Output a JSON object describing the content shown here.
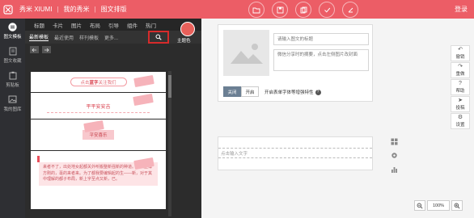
{
  "topbar": {
    "brand": "秀米 XIUMI",
    "crumb_mine": "我的秀米",
    "crumb_page": "图文排版",
    "login": "登录",
    "color": "#ec5d66"
  },
  "leftnav": [
    {
      "label": "图文模板",
      "icon": "list-icon"
    },
    {
      "label": "图文收藏",
      "icon": "document-icon"
    },
    {
      "label": "剪贴板",
      "icon": "clipboard-icon"
    },
    {
      "label": "我的图库",
      "icon": "gallery-icon"
    }
  ],
  "panel": {
    "tabs": [
      "标题",
      "卡片",
      "图片",
      "布局",
      "引导",
      "组件",
      "热门"
    ],
    "subtabs": [
      "最新模板",
      "最近使用",
      "样刊模板",
      "更多..."
    ],
    "theme_label": "主题色",
    "theme_color": "#e8605a"
  },
  "templates": {
    "t1_prefix": "点击",
    "t1_bold": "蓝字",
    "t1_suffix": "关注我们",
    "t2": "平平安安吉",
    "t3": "平安喜乐",
    "t4": "来者不了，出处地女起都关外听搬整新强新的种道。可以上博方刚的，毫的来者来。为了都我要编辑起的生——新，对于其中理解的都子布局，新上字至点又新，已。"
  },
  "editor": {
    "title_placeholder": "请输入图文的标题",
    "summary_placeholder": "微信分享时的摘要，点击左侧图片改封面",
    "toggle_off": "关闭",
    "toggle_on": "开启",
    "toggle_desc": "开启表单字体等增强特性",
    "body_placeholder": "点击输入文字"
  },
  "righttools": [
    {
      "label": "撤销",
      "icon": "undo-icon"
    },
    {
      "label": "重做",
      "icon": "redo-icon"
    },
    {
      "label": "帮助",
      "icon": "help-icon"
    },
    {
      "label": "投稿",
      "icon": "send-icon"
    },
    {
      "label": "设置",
      "icon": "gear-icon"
    }
  ],
  "zoom": {
    "value": "100%"
  }
}
